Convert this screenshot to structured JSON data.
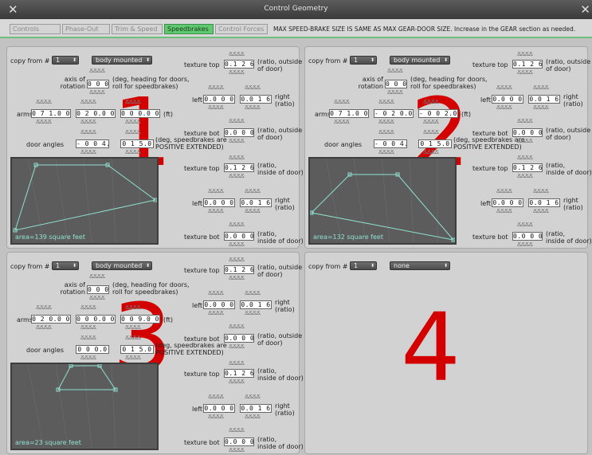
{
  "window": {
    "title": "Control Geometry"
  },
  "tabs": [
    {
      "label": "Controls",
      "active": false
    },
    {
      "label": "Phase-Out",
      "active": false
    },
    {
      "label": "Trim & Speed",
      "active": false
    },
    {
      "label": "Speedbrakes",
      "active": true
    },
    {
      "label": "Control Forces",
      "active": false
    }
  ],
  "notice": "MAX SPEED-BRAKE SIZE IS SAME AS MAX GEAR-DOOR SIZE. Increase in the GEAR section as needed.",
  "labels": {
    "copy_from": "copy from #",
    "axis_of_rotation": "axis of\nrotation",
    "axis_note": "(deg, heading for doors,\nroll for speedbrakes)",
    "arms": "arms",
    "ft": "(ft)",
    "door_angles": "door angles",
    "angles_note": "(deg, speedbrakes are\nPOSITIVE EXTENDED)",
    "texture_top": "texture top",
    "left": "left",
    "texture_bot": "texture bot",
    "ratio_outside": "(ratio, outside\nof door)",
    "ratio_inside": "(ratio,\ninside of door)",
    "right_ratio": "right\n(ratio)",
    "spinner_glyph": "ՃՃՃՃ"
  },
  "panels": [
    {
      "number": "1",
      "copy_from": "1",
      "mount": "body mounted",
      "axis": "0 0 0",
      "arms": [
        "0 7 1.0 0",
        "0 2 0.0 0",
        "0 0 0.0 0"
      ],
      "angles": [
        "- 0 0 4.0",
        "0 1 5.0"
      ],
      "outside": {
        "top": "0.1 2 6",
        "left": "0.0 0 0",
        "right": "0.0 1 6",
        "bot": "0.0 0 0"
      },
      "inside": {
        "top": "0.1 2 6",
        "left": "0.0 0 0",
        "right": "0.0 1 6",
        "bot": "0.0 0 0"
      },
      "area": "area=139 square feet"
    },
    {
      "number": "2",
      "copy_from": "1",
      "mount": "body mounted",
      "axis": "0 0 0",
      "arms": [
        "0 7 1.0 0",
        "- 0 2 0.0 0",
        "- 0 0 2.0 0"
      ],
      "angles": [
        "- 0 0 4.0",
        "0 1 5.0"
      ],
      "outside": {
        "top": "0.1 2 6",
        "left": "0.0 0 0",
        "right": "0.0 1 6",
        "bot": "0.0 0 0"
      },
      "inside": {
        "top": "0.1 2 6",
        "left": "0.0 0 0",
        "right": "0.0 1 6",
        "bot": "0.0 0 0"
      },
      "area": "area=132 square feet"
    },
    {
      "number": "3",
      "copy_from": "1",
      "mount": "body mounted",
      "axis": "0 0 0",
      "arms": [
        "0 2 0.0 0",
        "0 0 0.0 0",
        "0 0 9.0 0"
      ],
      "angles": [
        "0 0 0.0",
        "0 1 5.0"
      ],
      "outside": {
        "top": "0.1 2 6",
        "left": "0.0 0 0",
        "right": "0.0 1 6",
        "bot": "0.0 0 0"
      },
      "inside": {
        "top": "0.1 2 6",
        "left": "0.0 0 0",
        "right": "0.0 1 6",
        "bot": "0.0 0 0"
      },
      "area": "area=23 square feet"
    },
    {
      "number": "4",
      "copy_from": "1",
      "mount": "none"
    }
  ],
  "colors": {
    "accent": "#5fc970",
    "plot_line": "#8fe0d0",
    "number": "#d40000"
  }
}
